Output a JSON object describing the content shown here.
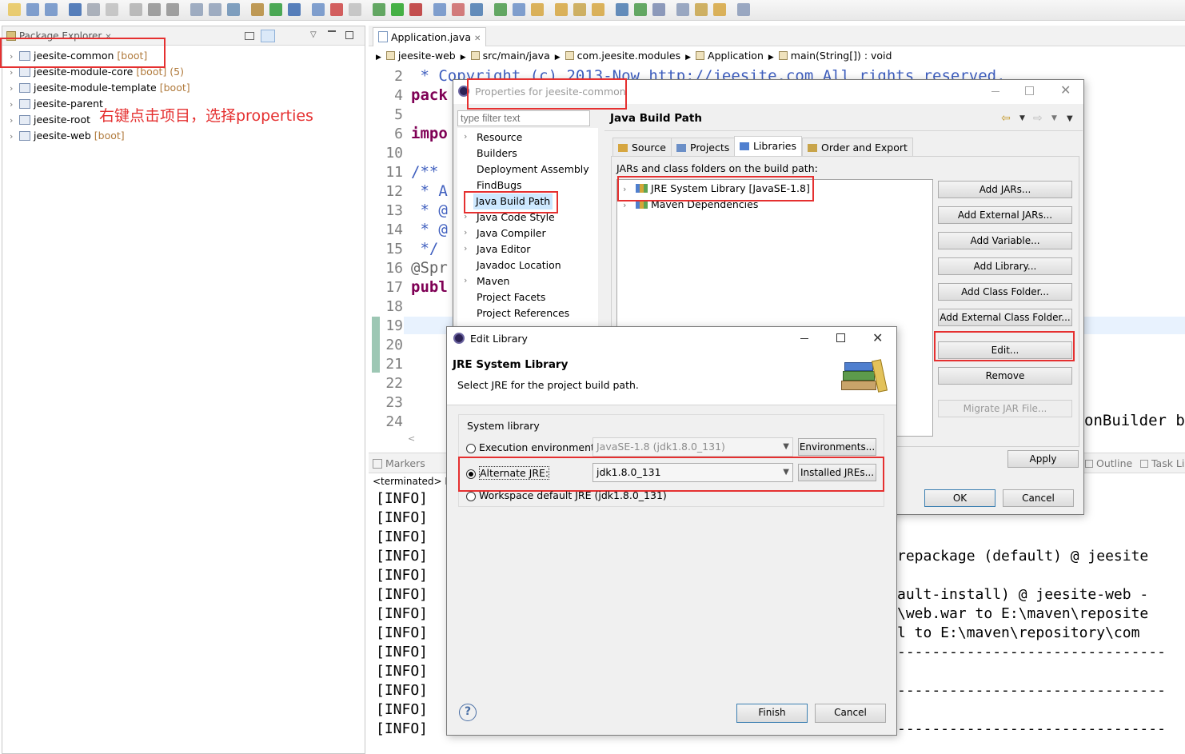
{
  "package_explorer": {
    "title": "Package Explorer",
    "close_glyph": "✕",
    "projects": [
      {
        "name": "jeesite-common",
        "tag": "[boot]",
        "extra": ""
      },
      {
        "name": "jeesite-module-core",
        "tag": "[boot]",
        "extra": "(5)"
      },
      {
        "name": "jeesite-module-template",
        "tag": "[boot]",
        "extra": ""
      },
      {
        "name": "jeesite-parent",
        "tag": "",
        "extra": ""
      },
      {
        "name": "jeesite-root",
        "tag": "",
        "extra": ""
      },
      {
        "name": "jeesite-web",
        "tag": "[boot]",
        "extra": ""
      }
    ],
    "annotation": "右键点击项目，选择properties"
  },
  "editor": {
    "tab_title": "Application.java",
    "breadcrumb": [
      "jeesite-web",
      "src/main/java",
      "com.jeesite.modules",
      "Application",
      "main(String[]) : void"
    ],
    "line_numbers": [
      "2",
      "4",
      "5",
      "6",
      "10",
      "11",
      "12",
      "13",
      "14",
      "15",
      "16",
      "17",
      "18",
      "19",
      "20",
      "21",
      "22",
      "23",
      "24"
    ],
    "code_lines": [
      " * Copyright (c) 2013-Now http://jeesite.com All rights reserved.",
      "pack",
      "",
      "impo",
      "",
      "/**",
      " * A",
      " * @",
      " * @",
      " */",
      "@Spr",
      "publ",
      "",
      "",
      "",
      "",
      "",
      "",
      ""
    ],
    "code_tail": "onBuilder b"
  },
  "console": {
    "tabs": [
      "Markers",
      "Outline",
      "Task Li"
    ],
    "terminated": "<terminated> E:",
    "lines": [
      "[INFO]",
      "[INFO]",
      "[INFO]",
      "[INFO]",
      "[INFO]",
      "[INFO]",
      "[INFO]",
      "[INFO]",
      "[INFO]",
      "[INFO]",
      "[INFO]",
      "[INFO]",
      "[INFO]"
    ],
    "right_lines": [
      {
        "row": 3,
        "text": "repackage (default) @ jeesite"
      },
      {
        "row": 5,
        "text": "ault-install) @ jeesite-web -"
      },
      {
        "row": 6,
        "text": "\\web.war to E:\\maven\\reposite"
      },
      {
        "row": 7,
        "text": "l to E:\\maven\\repository\\com"
      },
      {
        "row": 8,
        "text": "-------------------------------"
      },
      {
        "row": 10,
        "text": "-------------------------------"
      },
      {
        "row": 12,
        "text": "-------------------------------"
      }
    ]
  },
  "properties_dialog": {
    "title": "Properties for jeesite-common",
    "filter_placeholder": "type filter text",
    "nav": [
      {
        "label": "Resource",
        "expandable": true
      },
      {
        "label": "Builders",
        "expandable": false
      },
      {
        "label": "Deployment Assembly",
        "expandable": false
      },
      {
        "label": "FindBugs",
        "expandable": false
      },
      {
        "label": "Java Build Path",
        "expandable": false,
        "selected": true
      },
      {
        "label": "Java Code Style",
        "expandable": true
      },
      {
        "label": "Java Compiler",
        "expandable": true
      },
      {
        "label": "Java Editor",
        "expandable": true
      },
      {
        "label": "Javadoc Location",
        "expandable": false
      },
      {
        "label": "Maven",
        "expandable": true
      },
      {
        "label": "Project Facets",
        "expandable": false
      },
      {
        "label": "Project References",
        "expandable": false
      }
    ],
    "page_title": "Java Build Path",
    "tabs": [
      "Source",
      "Projects",
      "Libraries",
      "Order and Export"
    ],
    "active_tab": "Libraries",
    "jars_label": "JARs and class folders on the build path:",
    "entries": [
      "JRE System Library [JavaSE-1.8]",
      "Maven Dependencies"
    ],
    "buttons": [
      "Add JARs...",
      "Add External JARs...",
      "Add Variable...",
      "Add Library...",
      "Add Class Folder...",
      "Add External Class Folder...",
      "Edit...",
      "Remove",
      "Migrate JAR File..."
    ],
    "apply": "Apply",
    "ok": "OK",
    "cancel": "Cancel"
  },
  "edit_library_dialog": {
    "title": "Edit Library",
    "heading": "JRE System Library",
    "description": "Select JRE for the project build path.",
    "group_label": "System library",
    "execution_env_label": "Execution environment:",
    "execution_env_value": "JavaSE-1.8 (jdk1.8.0_131)",
    "environments_button": "Environments...",
    "alternate_jre_label": "Alternate JRE:",
    "alternate_jre_value": "jdk1.8.0_131",
    "installed_jres_button": "Installed JREs...",
    "workspace_default_label": "Workspace default JRE (jdk1.8.0_131)",
    "selected_option": "Alternate JRE",
    "finish": "Finish",
    "cancel": "Cancel",
    "help_glyph": "?"
  },
  "icons": [
    "new-icon",
    "save-icon",
    "save-all-icon",
    "run-icon",
    "debug-icon",
    "search-icon",
    "back-icon",
    "forward-icon"
  ],
  "colors": {
    "highlight_red": "#e53030",
    "selection_blue": "#cde8ff",
    "keyword": "#7f0055",
    "comment": "#3f5fbf"
  }
}
